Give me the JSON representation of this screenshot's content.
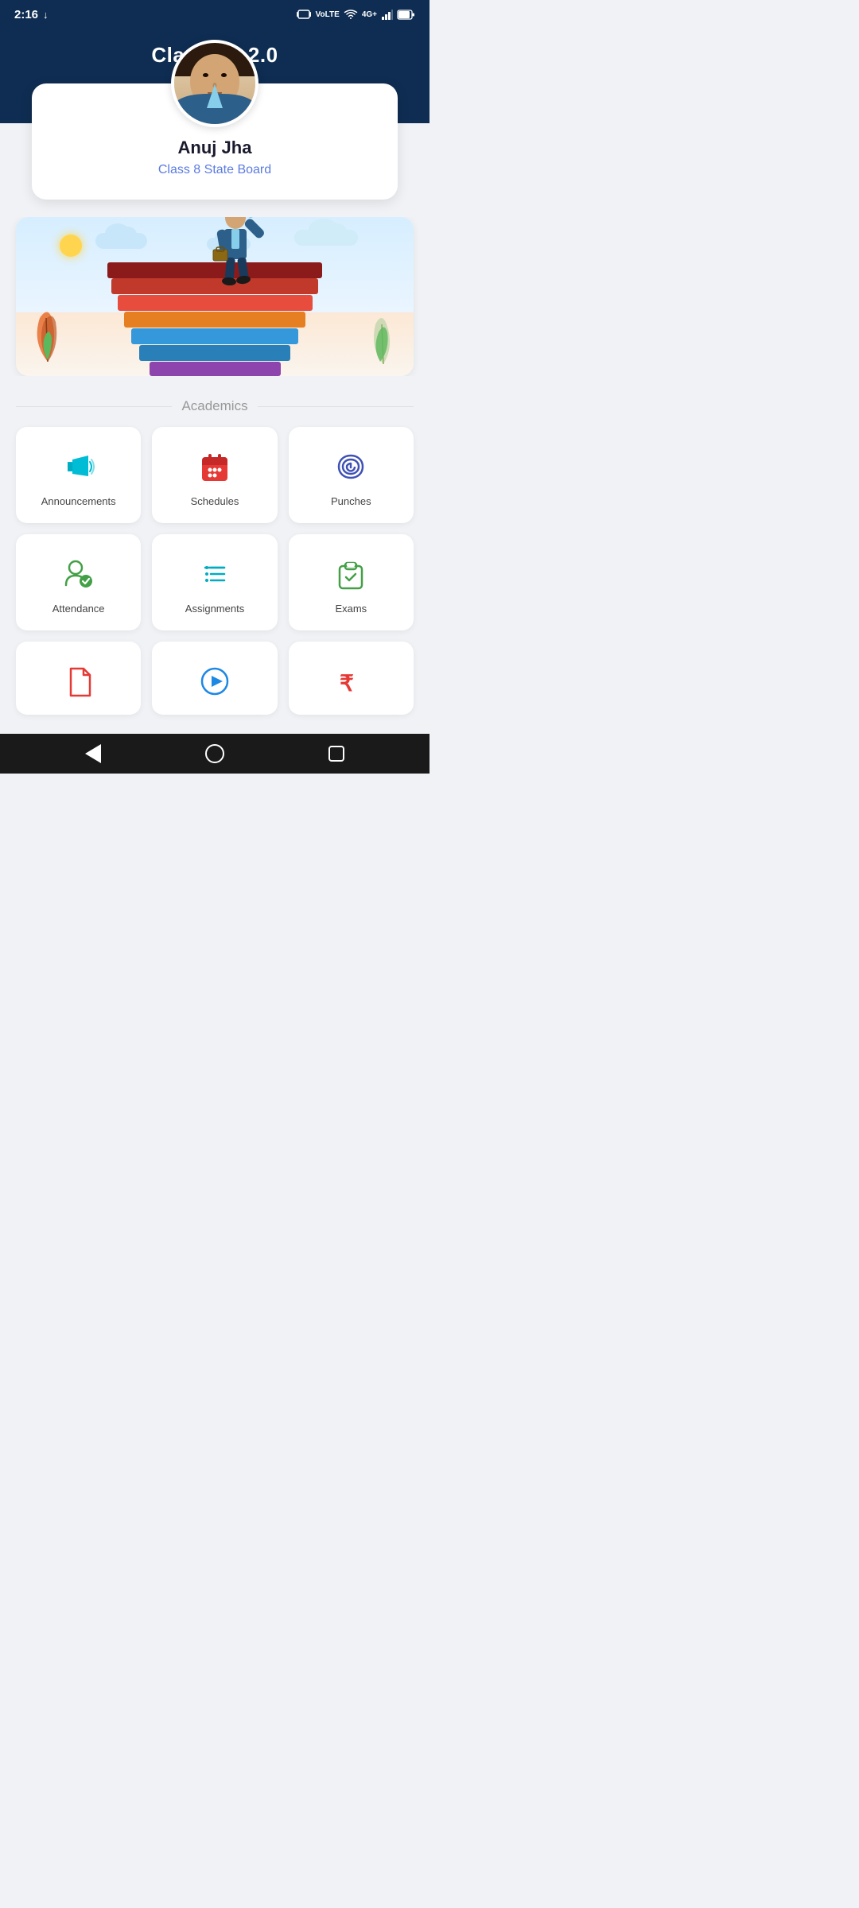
{
  "statusBar": {
    "time": "2:16",
    "downloadIcon": "↓",
    "networkIcons": "📳 LTE ▲ 4G+ ▲ 🔋"
  },
  "header": {
    "title": "Classbot 2.0"
  },
  "profile": {
    "name": "Anuj Jha",
    "class": "Class 8 State Board"
  },
  "sectionLabel": "Academics",
  "menuItems": [
    {
      "id": "announcements",
      "label": "Announcements",
      "iconColor": "#00bcd4"
    },
    {
      "id": "schedules",
      "label": "Schedules",
      "iconColor": "#e53935"
    },
    {
      "id": "punches",
      "label": "Punches",
      "iconColor": "#3f51b5"
    },
    {
      "id": "attendance",
      "label": "Attendance",
      "iconColor": "#43a047"
    },
    {
      "id": "assignments",
      "label": "Assignments",
      "iconColor": "#00acc1"
    },
    {
      "id": "exams",
      "label": "Exams",
      "iconColor": "#43a047"
    }
  ],
  "partialItems": [
    {
      "id": "notes",
      "label": "",
      "iconColor": "#e53935"
    },
    {
      "id": "video",
      "label": "",
      "iconColor": "#1e88e5"
    },
    {
      "id": "fees",
      "label": "",
      "iconColor": "#e53935"
    }
  ]
}
